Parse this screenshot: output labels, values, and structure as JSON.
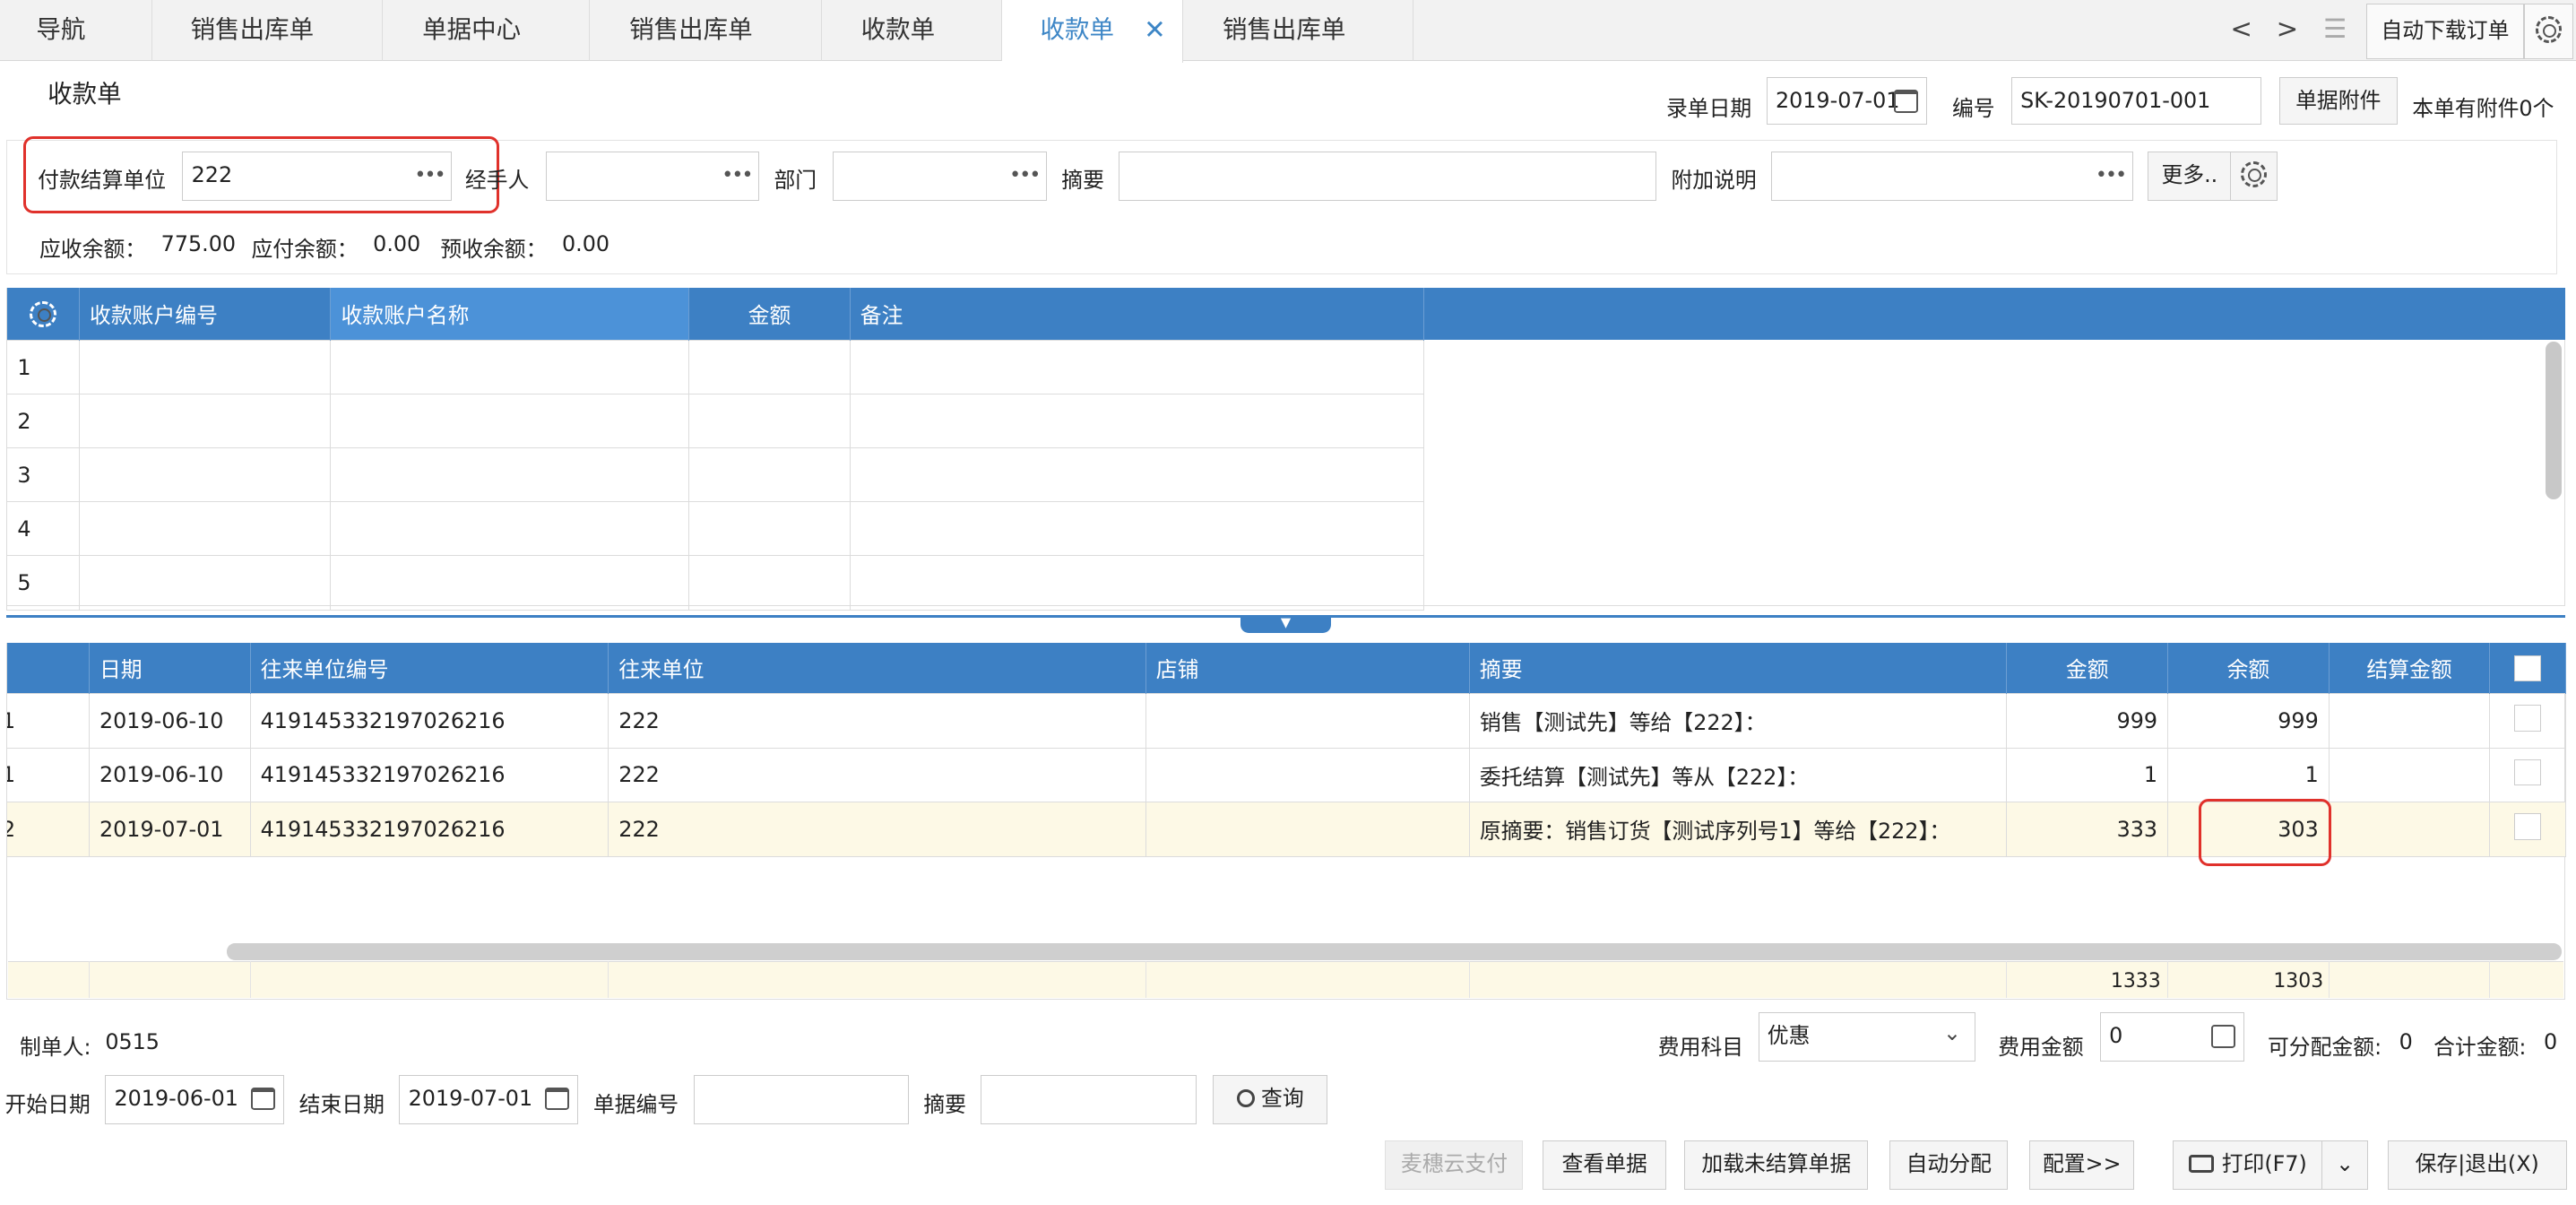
{
  "tabs": [
    "导航",
    "销售出库单",
    "单据中心",
    "销售出库单",
    "收款单",
    "收款单",
    "销售出库单"
  ],
  "top_buttons": {
    "prev": "<",
    "next": ">",
    "menu": "☰",
    "auto_download": "自动下载订单"
  },
  "page_title": "收款单",
  "header": {
    "date_label": "录单日期",
    "date_value": "2019-07-01",
    "number_label": "编号",
    "number_value": "SK-20190701-001",
    "attach_button": "单据附件",
    "attach_info": "本单有附件0个"
  },
  "form": {
    "payer_label": "付款结算单位",
    "payer_value": "222",
    "handler_label": "经手人",
    "handler_value": "",
    "dept_label": "部门",
    "dept_value": "",
    "summary_label": "摘要",
    "summary_value": "",
    "extra_label": "附加说明",
    "extra_value": "",
    "more_button": "更多.."
  },
  "balances": {
    "receivable_label": "应收余额：",
    "receivable_value": "775.00",
    "payable_label": "应付余额：",
    "payable_value": "0.00",
    "prepaid_label": "预收余额：",
    "prepaid_value": "0.00"
  },
  "account_grid": {
    "columns": [
      "收款账户编号",
      "收款账户名称",
      "金额",
      "备注"
    ],
    "rows": [
      "1",
      "2",
      "3",
      "4",
      "5"
    ]
  },
  "bill_grid": {
    "columns": [
      "日期",
      "往来单位编号",
      "往来单位",
      "店铺",
      "摘要",
      "金额",
      "余额",
      "结算金额"
    ],
    "rows": [
      {
        "idx": "1",
        "date": "2019-06-10",
        "code": "419145332197026216",
        "unit": "222",
        "shop": "",
        "summary": "销售【测试先】等给【222】：",
        "amount": "999",
        "balance": "999",
        "settle": ""
      },
      {
        "idx": "1",
        "date": "2019-06-10",
        "code": "419145332197026216",
        "unit": "222",
        "shop": "",
        "summary": "委托结算【测试先】等从【222】：",
        "amount": "1",
        "balance": "1",
        "settle": ""
      },
      {
        "idx": "2",
        "date": "2019-07-01",
        "code": "419145332197026216",
        "unit": "222",
        "shop": "",
        "summary": "原摘要：销售订货【测试序列号1】等给【222】：",
        "amount": "333",
        "balance": "303",
        "settle": ""
      }
    ],
    "totals": {
      "amount": "1333",
      "balance": "1303"
    }
  },
  "footer": {
    "maker_label": "制单人:",
    "maker_value": "0515",
    "fee_subject_label": "费用科目",
    "fee_subject_value": "优惠",
    "fee_amount_label": "费用金额",
    "fee_amount_value": "0",
    "allocatable_label": "可分配金额:",
    "allocatable_value": "0",
    "total_label": "合计金额:",
    "total_value": "0",
    "start_label": "开始日期",
    "start_value": "2019-06-01",
    "end_label": "结束日期",
    "end_value": "2019-07-01",
    "billno_label": "单据编号",
    "billno_value": "",
    "fsummary_label": "摘要",
    "fsummary_value": "",
    "query_button": "查询"
  },
  "actions": [
    "麦穗云支付",
    "查看单据",
    "加载未结算单据",
    "自动分配",
    "配置>>",
    "打印(F7)",
    "保存|退出(X)"
  ],
  "colors": {
    "accent": "#3d80c4",
    "highlight_row": "#fdf9e6",
    "alert": "#e0312b"
  }
}
